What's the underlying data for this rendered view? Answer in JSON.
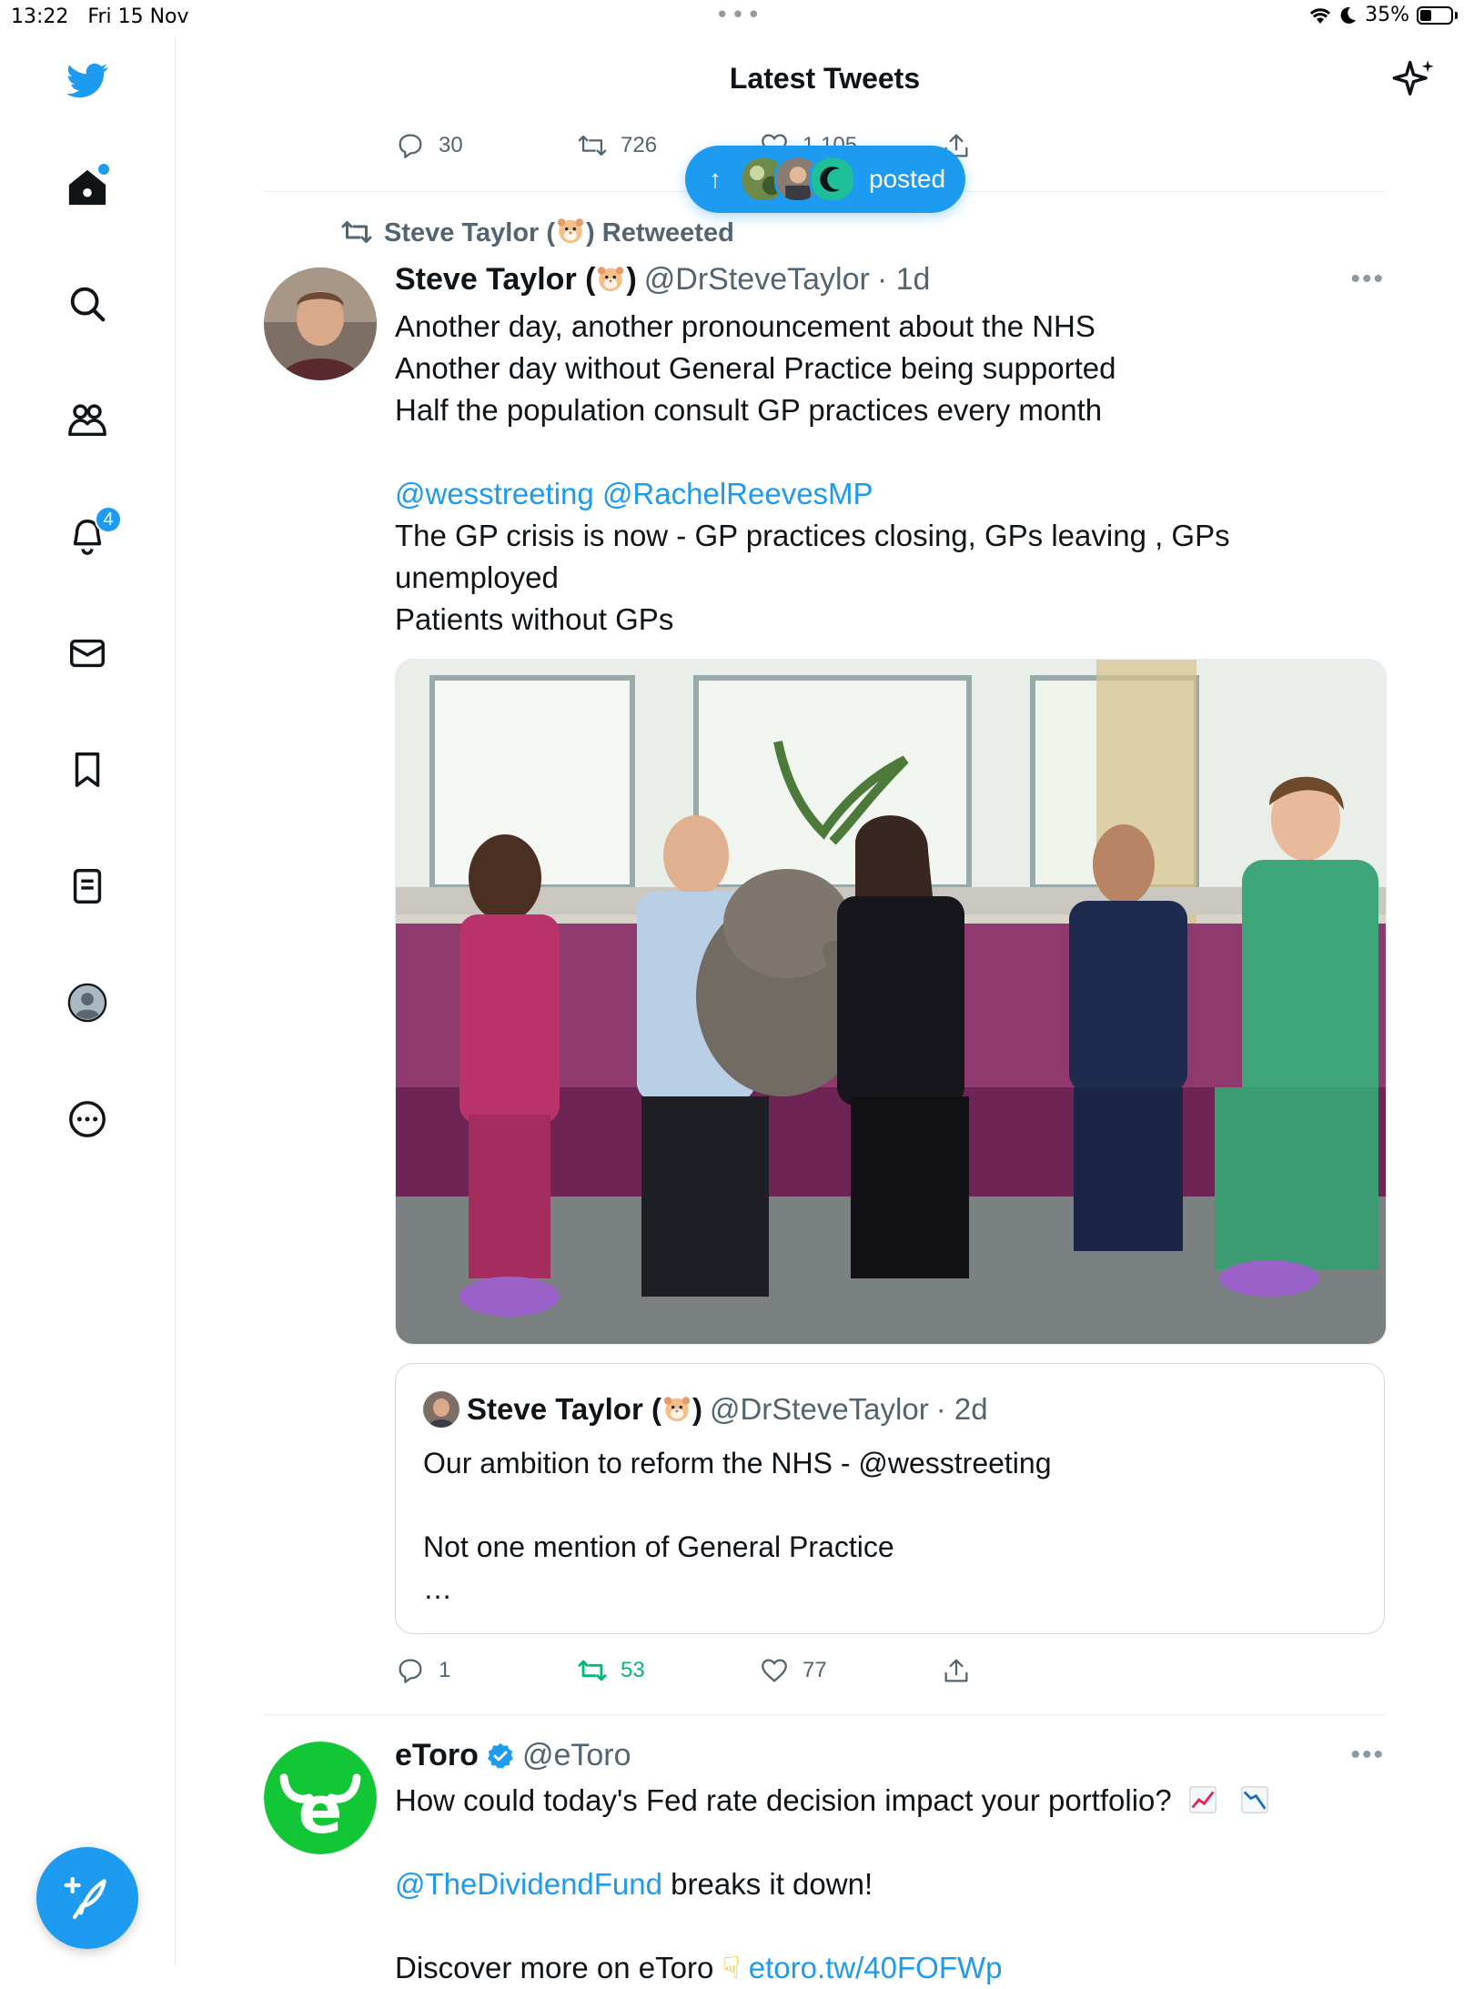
{
  "status_bar": {
    "time": "13:22",
    "date": "Fri 15 Nov",
    "battery": "35%"
  },
  "sidebar": {
    "notifications_badge": "4",
    "items": [
      "home",
      "search",
      "communities",
      "notifications",
      "messages",
      "bookmarks",
      "lists",
      "profile",
      "more"
    ]
  },
  "header": {
    "title": "Latest Tweets"
  },
  "prev_tweet_actions": {
    "replies": "30",
    "retweets": "726",
    "likes": "1,105"
  },
  "new_posts_pill": {
    "label": "posted"
  },
  "tweet1": {
    "retweeted_by": "Steve Taylor (",
    "retweeted_suffix": ") Retweeted",
    "name_prefix": "Steve Taylor (",
    "name_suffix": ")",
    "handle": "@DrSteveTaylor",
    "time": "· 1d",
    "lines": [
      "Another day, another pronouncement about the NHS",
      "Another day without General Practice being supported",
      "Half the population consult GP practices every month"
    ],
    "mention1": "@wesstreeting",
    "mention2": "@RachelReevesMP",
    "line4a": "The GP crisis is now - GP practices closing, GPs leaving , GPs",
    "line4b": "unemployed",
    "line5": "Patients without GPs",
    "quote": {
      "name_prefix": "Steve Taylor (",
      "name_suffix": ")",
      "handle": "@DrSteveTaylor",
      "time": "· 2d",
      "line1": "Our ambition to reform the NHS - @wesstreeting",
      "line2": "Not one mention of General Practice",
      "ellipsis": "…"
    },
    "actions": {
      "replies": "1",
      "retweets": "53",
      "likes": "77"
    }
  },
  "tweet2": {
    "name": "eToro",
    "handle": "@eToro",
    "line1": "How could today's Fed rate decision impact your portfolio?",
    "mention": "@TheDividendFund",
    "line2_rest": " breaks it down!",
    "line3": "Discover more on eToro",
    "link": "etoro.tw/40FOFWp"
  },
  "colors": {
    "accent": "#1d9bf0",
    "retweet_green": "#00ba7c",
    "etoro_green": "#13c636"
  }
}
